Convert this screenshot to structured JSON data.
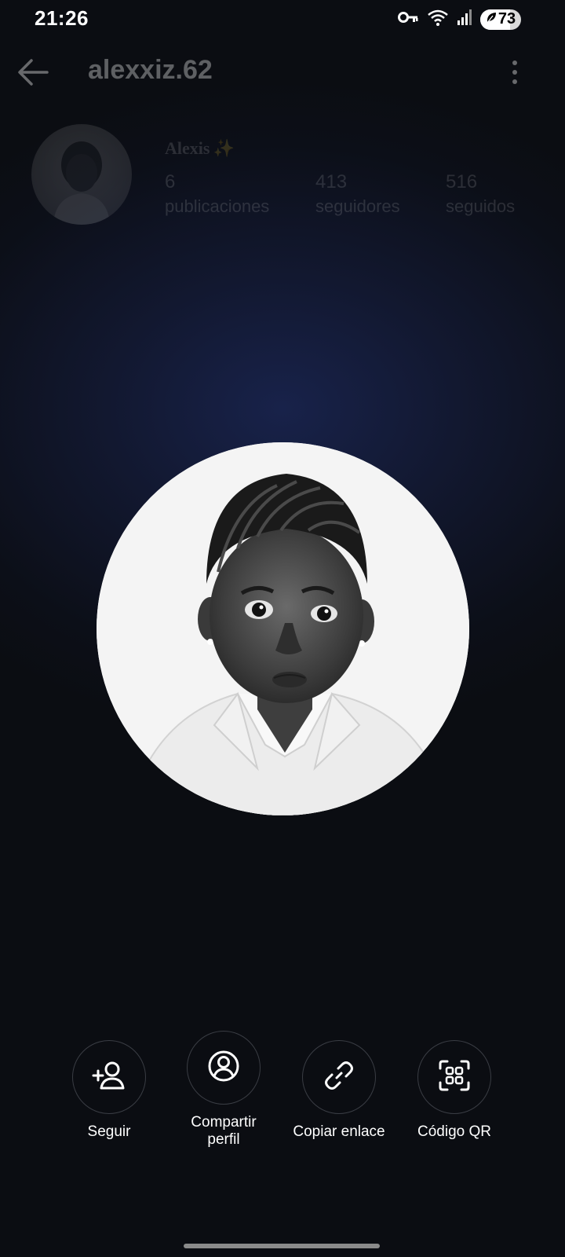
{
  "status_bar": {
    "time": "21:26",
    "battery_level": "73",
    "icons": [
      "vpn-key-icon",
      "wifi-icon",
      "signal-icon",
      "battery-icon"
    ]
  },
  "header": {
    "username": "alexxiz.62",
    "back_icon": "back-arrow-icon",
    "more_icon": "more-vertical-icon"
  },
  "profile": {
    "display_name": "Alexis",
    "stats": [
      {
        "value": "6",
        "label": "publicaciones"
      },
      {
        "value": "413",
        "label": "seguidores"
      },
      {
        "value": "516",
        "label": "seguidos"
      }
    ]
  },
  "actions": [
    {
      "label": "Seguir",
      "icon": "follow-user-icon"
    },
    {
      "label": "Compartir perfil",
      "icon": "share-profile-icon"
    },
    {
      "label": "Copiar enlace",
      "icon": "link-icon"
    },
    {
      "label": "Código QR",
      "icon": "qr-code-icon"
    }
  ],
  "colors": {
    "background_dark": "#0b0d12",
    "background_glow": "#18224a",
    "text": "#ffffff",
    "button_border": "#3a3d44"
  }
}
